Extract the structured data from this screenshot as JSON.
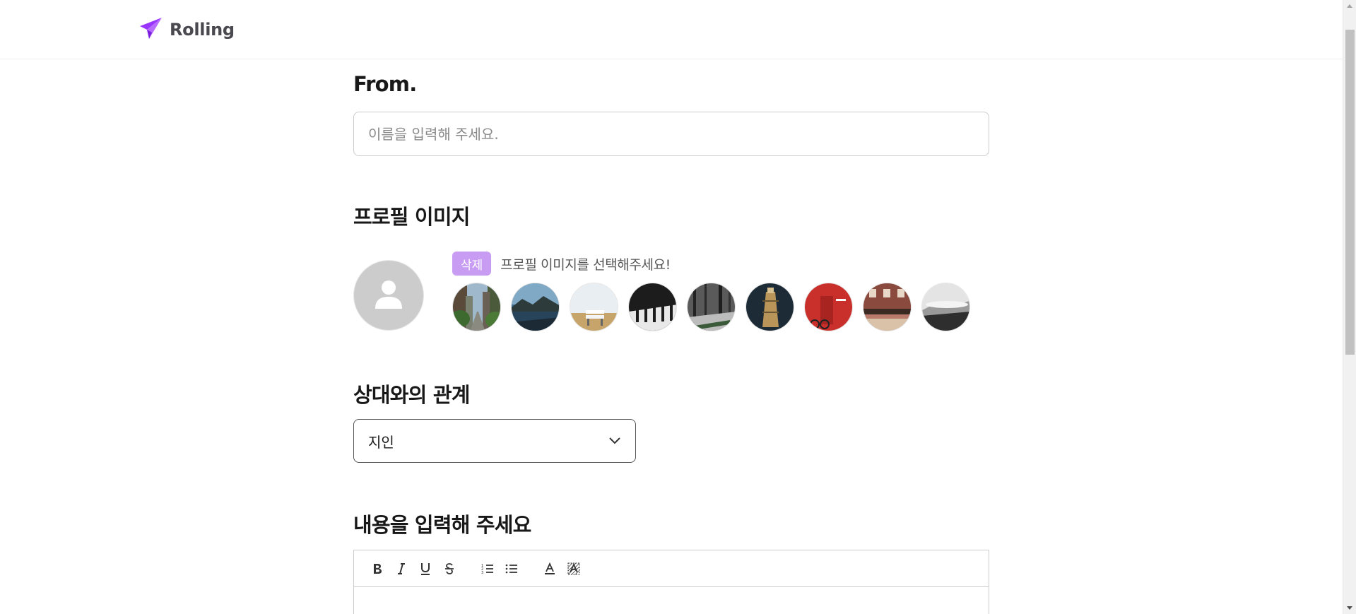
{
  "header": {
    "logo_text": "Rolling",
    "logo_icon": "paper-plane-icon",
    "accent_color": "#9935ff"
  },
  "from": {
    "title": "From.",
    "placeholder": "이름을 입력해 주세요."
  },
  "profile": {
    "title": "프로필 이미지",
    "delete_label": "삭제",
    "hint": "프로필 이미지를 선택해주세요!",
    "thumbnails": [
      "city-street-image",
      "mountain-lake-image",
      "white-bench-image",
      "piano-keys-image",
      "forest-stream-image",
      "lighthouse-image",
      "red-door-image",
      "street-cafe-image",
      "misty-mountain-image"
    ]
  },
  "relation": {
    "title": "상대와의 관계",
    "selected": "지인"
  },
  "content": {
    "title": "내용을 입력해 주세요",
    "toolbar": [
      "bold-icon",
      "italic-icon",
      "underline-icon",
      "strikethrough-icon",
      "ordered-list-icon",
      "bullet-list-icon",
      "text-color-icon",
      "background-color-icon"
    ]
  }
}
